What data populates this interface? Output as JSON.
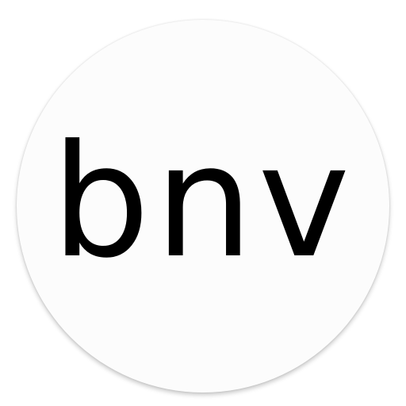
{
  "app_icon": {
    "label": "bnv",
    "background_color": "#fcfcfc",
    "text_color": "#000000"
  }
}
